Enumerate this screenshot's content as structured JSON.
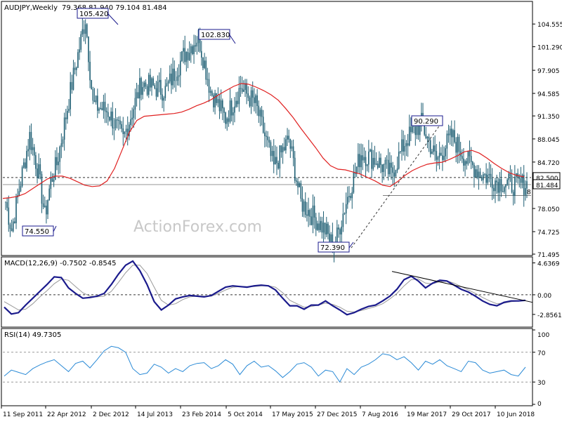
{
  "header": {
    "symbol": "AUDJPY,Weekly",
    "ohlc": "79.368 81.940 79.104 81.484"
  },
  "watermark": "ActionForex.com",
  "x_labels": [
    "11 Sep 2011",
    "22 Apr 2012",
    "2 Dec 2012",
    "14 Jul 2013",
    "23 Feb 2014",
    "5 Oct 2014",
    "17 May 2015",
    "27 Dec 2015",
    "7 Aug 2016",
    "19 Mar 2017",
    "29 Oct 2017",
    "10 Jun 2018"
  ],
  "colors": {
    "bull": "#1f5f74",
    "bear": "#1f5f74",
    "ma": "#e02020",
    "macd": "#1a1a8c",
    "signal": "#9a9a9a",
    "rsi": "#2a8ad6",
    "box": "#1a1a8c"
  },
  "chart_data": [
    {
      "type": "candlestick",
      "title": "AUDJPY,Weekly",
      "ylim": [
        71.495,
        107.6
      ],
      "y_ticks": [
        "104.555",
        "101.290",
        "97.905",
        "94.585",
        "91.350",
        "88.045",
        "84.720",
        "78.050",
        "74.725",
        "71.495"
      ],
      "current_price": "81.484",
      "level_line": "82.500",
      "cut_label": "8",
      "annotations": [
        {
          "label": "105.420",
          "value": 105.42
        },
        {
          "label": "102.830",
          "value": 102.83
        },
        {
          "label": "74.550",
          "value": 74.55
        },
        {
          "label": "72.390",
          "value": 72.39
        },
        {
          "label": "90.290",
          "value": 90.29
        }
      ],
      "ma_series": [
        79.5,
        79.6,
        79.8,
        80.2,
        80.9,
        81.6,
        82.3,
        82.7,
        82.7,
        82.4,
        81.9,
        81.4,
        81.2,
        81.3,
        82.0,
        83.8,
        86.4,
        89.0,
        90.7,
        91.3,
        91.4,
        91.5,
        91.6,
        91.7,
        91.9,
        92.3,
        92.8,
        93.2,
        93.7,
        94.4,
        95.0,
        95.6,
        96.0,
        95.9,
        95.5,
        95.0,
        94.4,
        93.6,
        92.4,
        91.1,
        89.6,
        88.2,
        86.8,
        85.3,
        84.2,
        83.7,
        83.6,
        83.3,
        83.0,
        82.5,
        82.0,
        81.4,
        81.2,
        81.9,
        82.8,
        83.5,
        84.0,
        84.4,
        84.6,
        84.7,
        85.1,
        85.6,
        86.2,
        86.4,
        86.0,
        85.3,
        84.5,
        83.8,
        83.2,
        82.8,
        82.6
      ]
    },
    {
      "type": "line",
      "title": "MACD(12,26,9) -0.7502 -0.8545",
      "y_ticks": [
        "4.6369",
        "0.00",
        "-2.8561"
      ],
      "ylim": [
        -4.5,
        5.3
      ],
      "series": [
        {
          "name": "MACD",
          "values": [
            -1.8,
            -2.8,
            -2.6,
            -1.5,
            -0.5,
            0.5,
            1.5,
            2.6,
            2.5,
            1.0,
            0.2,
            -0.5,
            -0.4,
            -0.2,
            0.2,
            1.5,
            3.0,
            4.3,
            4.9,
            3.5,
            1.5,
            -1.0,
            -2.2,
            -1.5,
            -0.6,
            -0.3,
            -0.1,
            -0.2,
            -0.3,
            -0.1,
            0.5,
            1.1,
            1.3,
            1.2,
            1.1,
            1.3,
            1.4,
            1.3,
            0.7,
            -0.5,
            -1.6,
            -1.6,
            -2.1,
            -1.5,
            -1.5,
            -0.9,
            -1.6,
            -2.2,
            -2.9,
            -2.6,
            -2.1,
            -1.7,
            -1.5,
            -0.9,
            -0.2,
            0.8,
            2.2,
            2.7,
            2.0,
            1.0,
            1.7,
            2.1,
            2.0,
            1.4,
            0.8,
            0.4,
            -0.2,
            -0.9,
            -1.4,
            -1.6,
            -1.1,
            -0.9,
            -0.9,
            -0.8
          ]
        },
        {
          "name": "Signal",
          "values": [
            -1.0,
            -1.6,
            -2.2,
            -2.1,
            -1.3,
            -0.3,
            0.6,
            1.6,
            2.3,
            2.1,
            1.2,
            0.3,
            -0.2,
            -0.3,
            -0.2,
            0.5,
            1.8,
            3.2,
            4.3,
            4.3,
            3.1,
            1.1,
            -0.8,
            -1.5,
            -1.3,
            -0.7,
            -0.3,
            -0.2,
            -0.2,
            -0.2,
            0.2,
            0.7,
            1.1,
            1.2,
            1.2,
            1.2,
            1.3,
            1.3,
            1.1,
            0.3,
            -0.8,
            -1.3,
            -1.8,
            -1.7,
            -1.5,
            -1.2,
            -1.4,
            -1.8,
            -2.4,
            -2.5,
            -2.3,
            -2.0,
            -1.7,
            -1.3,
            -0.6,
            0.2,
            1.3,
            2.2,
            2.3,
            1.7,
            1.6,
            1.9,
            2.0,
            1.7,
            1.2,
            0.7,
            0.2,
            -0.4,
            -0.9,
            -1.3,
            -1.2,
            -1.0,
            -0.9,
            -0.85
          ]
        }
      ]
    },
    {
      "type": "line",
      "title": "RSI(14) 49.7305",
      "y_ticks": [
        "100",
        "70",
        "30",
        "0"
      ],
      "ylim": [
        0,
        100
      ],
      "series": [
        {
          "name": "RSI",
          "values": [
            38,
            46,
            43,
            40,
            48,
            53,
            57,
            60,
            52,
            44,
            55,
            58,
            49,
            60,
            72,
            78,
            76,
            70,
            48,
            40,
            42,
            54,
            50,
            42,
            48,
            44,
            52,
            55,
            56,
            48,
            52,
            60,
            54,
            40,
            52,
            58,
            50,
            52,
            45,
            36,
            44,
            54,
            56,
            50,
            38,
            46,
            44,
            30,
            48,
            40,
            50,
            54,
            60,
            68,
            66,
            60,
            64,
            56,
            46,
            58,
            54,
            60,
            52,
            48,
            44,
            58,
            56,
            46,
            42,
            44,
            46,
            40,
            38,
            50
          ]
        }
      ]
    }
  ]
}
